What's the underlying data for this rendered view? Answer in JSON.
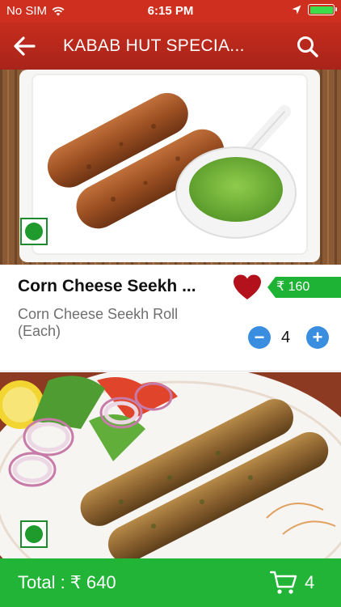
{
  "status_bar": {
    "carrier": "No SIM",
    "time": "6:15 PM",
    "battery_level": 1.0
  },
  "header": {
    "title": "KABAB HUT SPECIA...",
    "back_icon": "arrow-left-icon",
    "search_icon": "search-icon"
  },
  "products": [
    {
      "name": "Corn Cheese Seekh ...",
      "description": "Corn Cheese Seekh Roll (Each)",
      "price": "₹ 160",
      "quantity": "4",
      "favorited": true,
      "veg": true
    },
    {
      "veg": true
    }
  ],
  "footer": {
    "total_label": "Total : ₹ 640",
    "cart_count": "4",
    "cart_icon": "cart-icon"
  },
  "colors": {
    "header_red": "#c62d1d",
    "price_green": "#1fb336",
    "footer_green": "#22b436",
    "stepper_blue": "#3a8ee0",
    "heart_red": "#b3111b"
  }
}
